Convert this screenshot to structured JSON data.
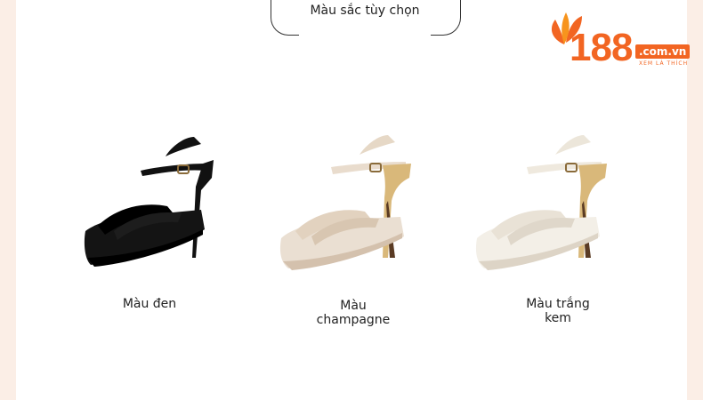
{
  "header": {
    "title": "Màu sắc tùy chọn"
  },
  "logo": {
    "number": "188",
    "domain": ".com.vn",
    "tagline": "XEM LÀ THÍCH"
  },
  "colors": {
    "accent": "#f26522",
    "background": "#fbeee6"
  },
  "products": [
    {
      "label": "Màu đen",
      "color": "#111111"
    },
    {
      "label": "Màu champagne",
      "color": "#e9dccd"
    },
    {
      "label": "Màu trắng kem",
      "color": "#f1ece2"
    }
  ]
}
